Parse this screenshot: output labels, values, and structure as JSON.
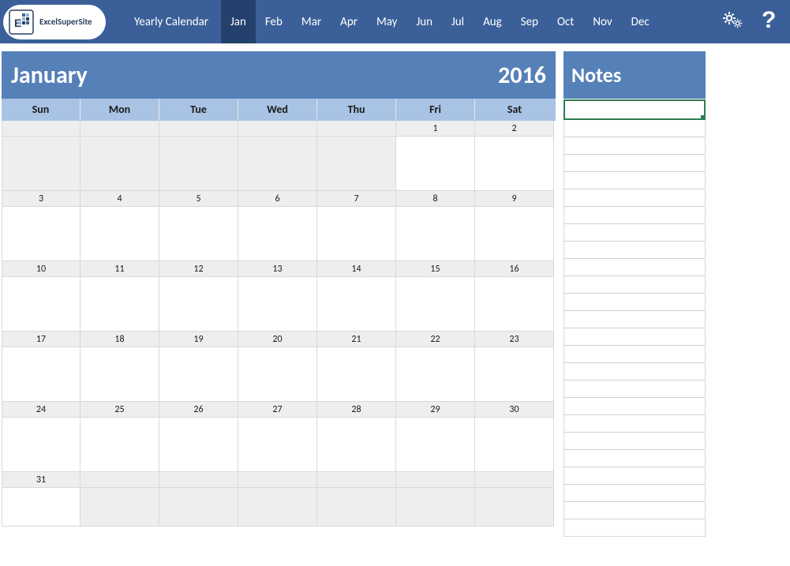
{
  "brand": {
    "name": "ExcelSuperSite"
  },
  "tabs": {
    "yearly": "Yearly Calendar",
    "months": [
      "Jan",
      "Feb",
      "Mar",
      "Apr",
      "May",
      "Jun",
      "Jul",
      "Aug",
      "Sep",
      "Oct",
      "Nov",
      "Dec"
    ],
    "active": "Jan"
  },
  "calendar": {
    "month": "January",
    "year": "2016",
    "dow": [
      "Sun",
      "Mon",
      "Tue",
      "Wed",
      "Thu",
      "Fri",
      "Sat"
    ],
    "weeks": [
      [
        null,
        null,
        null,
        null,
        null,
        1,
        2
      ],
      [
        3,
        4,
        5,
        6,
        7,
        8,
        9
      ],
      [
        10,
        11,
        12,
        13,
        14,
        15,
        16
      ],
      [
        17,
        18,
        19,
        20,
        21,
        22,
        23
      ],
      [
        24,
        25,
        26,
        27,
        28,
        29,
        30
      ],
      [
        31,
        null,
        null,
        null,
        null,
        null,
        null
      ]
    ]
  },
  "notes": {
    "title": "Notes"
  }
}
